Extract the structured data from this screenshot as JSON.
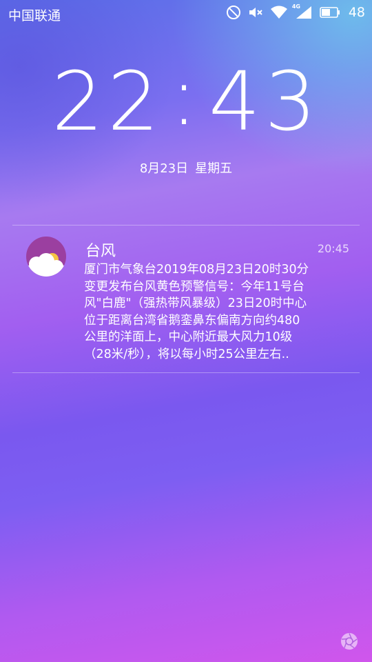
{
  "status_bar": {
    "carrier": "中国联通",
    "network_badge": "4G",
    "battery_level": "48",
    "icons": [
      "do-not-disturb-icon",
      "mute-icon",
      "wifi-icon",
      "signal-icon",
      "battery-icon"
    ]
  },
  "lockscreen": {
    "hour": "22",
    "separator": ":",
    "minute": "43",
    "date": "8月23日",
    "weekday": "星期五"
  },
  "notification": {
    "app_icon": "weather-icon",
    "title": "台风",
    "time": "20:45",
    "body_lines": [
      "厦门市气象台2019年08月23日20时30分",
      "变更发布台风黄色预警信号：今年11号台",
      "风\"白鹿\"（强热带风暴级）23日20时中心",
      "位于距离台湾省鹅銮鼻东偏南方向约480",
      "公里的洋面上，中心附近最大风力10级",
      "（28米/秒），将以每小时25公里左右.."
    ]
  },
  "shortcut": {
    "icon": "camera-shutter-icon"
  }
}
